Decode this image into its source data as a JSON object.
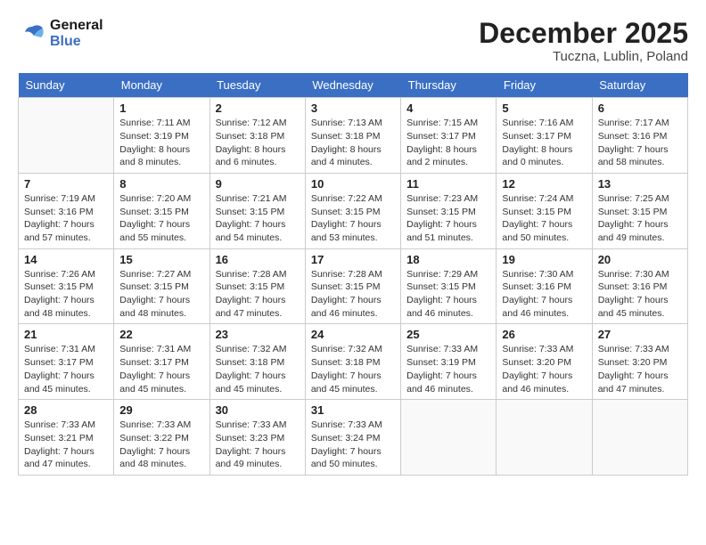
{
  "header": {
    "logo_general": "General",
    "logo_blue": "Blue",
    "month_year": "December 2025",
    "location": "Tuczna, Lublin, Poland"
  },
  "days_of_week": [
    "Sunday",
    "Monday",
    "Tuesday",
    "Wednesday",
    "Thursday",
    "Friday",
    "Saturday"
  ],
  "weeks": [
    [
      {
        "day": "",
        "sunrise": "",
        "sunset": "",
        "daylight": ""
      },
      {
        "day": "1",
        "sunrise": "Sunrise: 7:11 AM",
        "sunset": "Sunset: 3:19 PM",
        "daylight": "Daylight: 8 hours and 8 minutes."
      },
      {
        "day": "2",
        "sunrise": "Sunrise: 7:12 AM",
        "sunset": "Sunset: 3:18 PM",
        "daylight": "Daylight: 8 hours and 6 minutes."
      },
      {
        "day": "3",
        "sunrise": "Sunrise: 7:13 AM",
        "sunset": "Sunset: 3:18 PM",
        "daylight": "Daylight: 8 hours and 4 minutes."
      },
      {
        "day": "4",
        "sunrise": "Sunrise: 7:15 AM",
        "sunset": "Sunset: 3:17 PM",
        "daylight": "Daylight: 8 hours and 2 minutes."
      },
      {
        "day": "5",
        "sunrise": "Sunrise: 7:16 AM",
        "sunset": "Sunset: 3:17 PM",
        "daylight": "Daylight: 8 hours and 0 minutes."
      },
      {
        "day": "6",
        "sunrise": "Sunrise: 7:17 AM",
        "sunset": "Sunset: 3:16 PM",
        "daylight": "Daylight: 7 hours and 58 minutes."
      }
    ],
    [
      {
        "day": "7",
        "sunrise": "Sunrise: 7:19 AM",
        "sunset": "Sunset: 3:16 PM",
        "daylight": "Daylight: 7 hours and 57 minutes."
      },
      {
        "day": "8",
        "sunrise": "Sunrise: 7:20 AM",
        "sunset": "Sunset: 3:15 PM",
        "daylight": "Daylight: 7 hours and 55 minutes."
      },
      {
        "day": "9",
        "sunrise": "Sunrise: 7:21 AM",
        "sunset": "Sunset: 3:15 PM",
        "daylight": "Daylight: 7 hours and 54 minutes."
      },
      {
        "day": "10",
        "sunrise": "Sunrise: 7:22 AM",
        "sunset": "Sunset: 3:15 PM",
        "daylight": "Daylight: 7 hours and 53 minutes."
      },
      {
        "day": "11",
        "sunrise": "Sunrise: 7:23 AM",
        "sunset": "Sunset: 3:15 PM",
        "daylight": "Daylight: 7 hours and 51 minutes."
      },
      {
        "day": "12",
        "sunrise": "Sunrise: 7:24 AM",
        "sunset": "Sunset: 3:15 PM",
        "daylight": "Daylight: 7 hours and 50 minutes."
      },
      {
        "day": "13",
        "sunrise": "Sunrise: 7:25 AM",
        "sunset": "Sunset: 3:15 PM",
        "daylight": "Daylight: 7 hours and 49 minutes."
      }
    ],
    [
      {
        "day": "14",
        "sunrise": "Sunrise: 7:26 AM",
        "sunset": "Sunset: 3:15 PM",
        "daylight": "Daylight: 7 hours and 48 minutes."
      },
      {
        "day": "15",
        "sunrise": "Sunrise: 7:27 AM",
        "sunset": "Sunset: 3:15 PM",
        "daylight": "Daylight: 7 hours and 48 minutes."
      },
      {
        "day": "16",
        "sunrise": "Sunrise: 7:28 AM",
        "sunset": "Sunset: 3:15 PM",
        "daylight": "Daylight: 7 hours and 47 minutes."
      },
      {
        "day": "17",
        "sunrise": "Sunrise: 7:28 AM",
        "sunset": "Sunset: 3:15 PM",
        "daylight": "Daylight: 7 hours and 46 minutes."
      },
      {
        "day": "18",
        "sunrise": "Sunrise: 7:29 AM",
        "sunset": "Sunset: 3:15 PM",
        "daylight": "Daylight: 7 hours and 46 minutes."
      },
      {
        "day": "19",
        "sunrise": "Sunrise: 7:30 AM",
        "sunset": "Sunset: 3:16 PM",
        "daylight": "Daylight: 7 hours and 46 minutes."
      },
      {
        "day": "20",
        "sunrise": "Sunrise: 7:30 AM",
        "sunset": "Sunset: 3:16 PM",
        "daylight": "Daylight: 7 hours and 45 minutes."
      }
    ],
    [
      {
        "day": "21",
        "sunrise": "Sunrise: 7:31 AM",
        "sunset": "Sunset: 3:17 PM",
        "daylight": "Daylight: 7 hours and 45 minutes."
      },
      {
        "day": "22",
        "sunrise": "Sunrise: 7:31 AM",
        "sunset": "Sunset: 3:17 PM",
        "daylight": "Daylight: 7 hours and 45 minutes."
      },
      {
        "day": "23",
        "sunrise": "Sunrise: 7:32 AM",
        "sunset": "Sunset: 3:18 PM",
        "daylight": "Daylight: 7 hours and 45 minutes."
      },
      {
        "day": "24",
        "sunrise": "Sunrise: 7:32 AM",
        "sunset": "Sunset: 3:18 PM",
        "daylight": "Daylight: 7 hours and 45 minutes."
      },
      {
        "day": "25",
        "sunrise": "Sunrise: 7:33 AM",
        "sunset": "Sunset: 3:19 PM",
        "daylight": "Daylight: 7 hours and 46 minutes."
      },
      {
        "day": "26",
        "sunrise": "Sunrise: 7:33 AM",
        "sunset": "Sunset: 3:20 PM",
        "daylight": "Daylight: 7 hours and 46 minutes."
      },
      {
        "day": "27",
        "sunrise": "Sunrise: 7:33 AM",
        "sunset": "Sunset: 3:20 PM",
        "daylight": "Daylight: 7 hours and 47 minutes."
      }
    ],
    [
      {
        "day": "28",
        "sunrise": "Sunrise: 7:33 AM",
        "sunset": "Sunset: 3:21 PM",
        "daylight": "Daylight: 7 hours and 47 minutes."
      },
      {
        "day": "29",
        "sunrise": "Sunrise: 7:33 AM",
        "sunset": "Sunset: 3:22 PM",
        "daylight": "Daylight: 7 hours and 48 minutes."
      },
      {
        "day": "30",
        "sunrise": "Sunrise: 7:33 AM",
        "sunset": "Sunset: 3:23 PM",
        "daylight": "Daylight: 7 hours and 49 minutes."
      },
      {
        "day": "31",
        "sunrise": "Sunrise: 7:33 AM",
        "sunset": "Sunset: 3:24 PM",
        "daylight": "Daylight: 7 hours and 50 minutes."
      },
      {
        "day": "",
        "sunrise": "",
        "sunset": "",
        "daylight": ""
      },
      {
        "day": "",
        "sunrise": "",
        "sunset": "",
        "daylight": ""
      },
      {
        "day": "",
        "sunrise": "",
        "sunset": "",
        "daylight": ""
      }
    ]
  ]
}
